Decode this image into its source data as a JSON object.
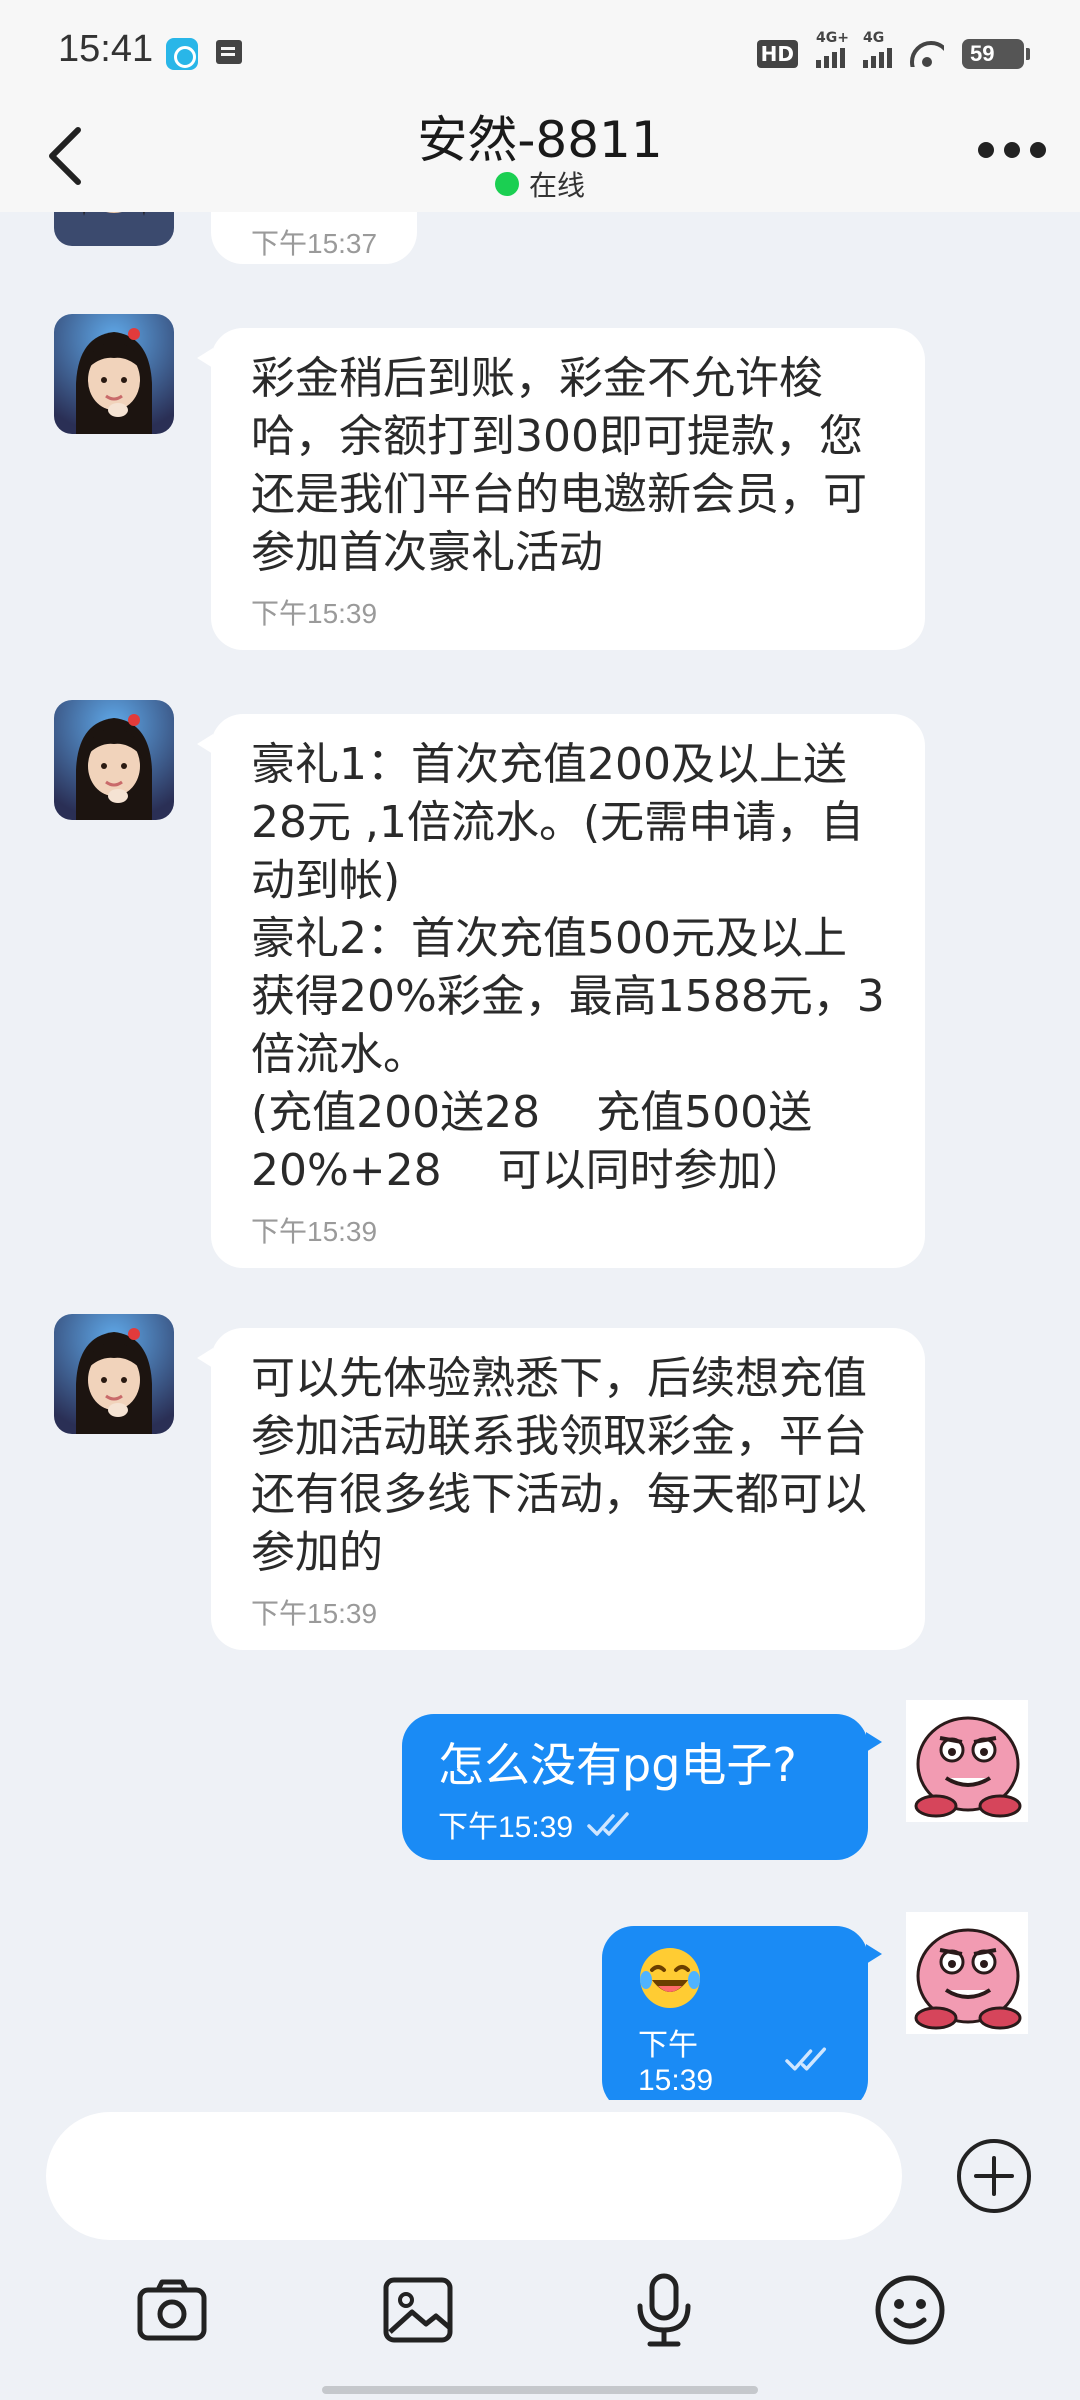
{
  "status_bar": {
    "time": "15:41",
    "hd_label": "HD",
    "signal1_label": "4G+",
    "signal2_label": "4G",
    "battery": "59"
  },
  "header": {
    "title": "安然-8811",
    "status": "在线",
    "online_color": "#1bcf52"
  },
  "messages": [
    {
      "direction": "incoming",
      "text": "",
      "time": "下午15:37"
    },
    {
      "direction": "incoming",
      "text": "彩金稍后到账，彩金不允许梭哈，余额打到300即可提款，您还是我们平台的电邀新会员，可参加首次豪礼活动",
      "time": "下午15:39"
    },
    {
      "direction": "incoming",
      "text": "豪礼1：首次充值200及以上送28元 ,1倍流水。(无需申请，自动到帐)\n豪礼2：首次充值500元及以上获得20%彩金，最高1588元，3倍流水。\n(充值200送28    充值500送20%+28    可以同时参加）",
      "time": "下午15:39"
    },
    {
      "direction": "incoming",
      "text": "可以先体验熟悉下，后续想充值参加活动联系我领取彩金，平台还有很多线下活动，每天都可以参加的",
      "time": "下午15:39"
    },
    {
      "direction": "outgoing",
      "text": "怎么没有pg电子?",
      "time": "下午15:39",
      "read": true
    },
    {
      "direction": "outgoing",
      "text": "",
      "emoji": "laughing-with-tears",
      "time": "下午15:39",
      "read": true
    }
  ],
  "input": {
    "placeholder": ""
  },
  "toolbar": {
    "icons": [
      "camera-icon",
      "image-icon",
      "microphone-icon",
      "emoji-icon"
    ]
  },
  "colors": {
    "outgoing_bubble": "#1a8bf5",
    "incoming_bubble": "#ffffff",
    "background": "#eef1f6"
  }
}
